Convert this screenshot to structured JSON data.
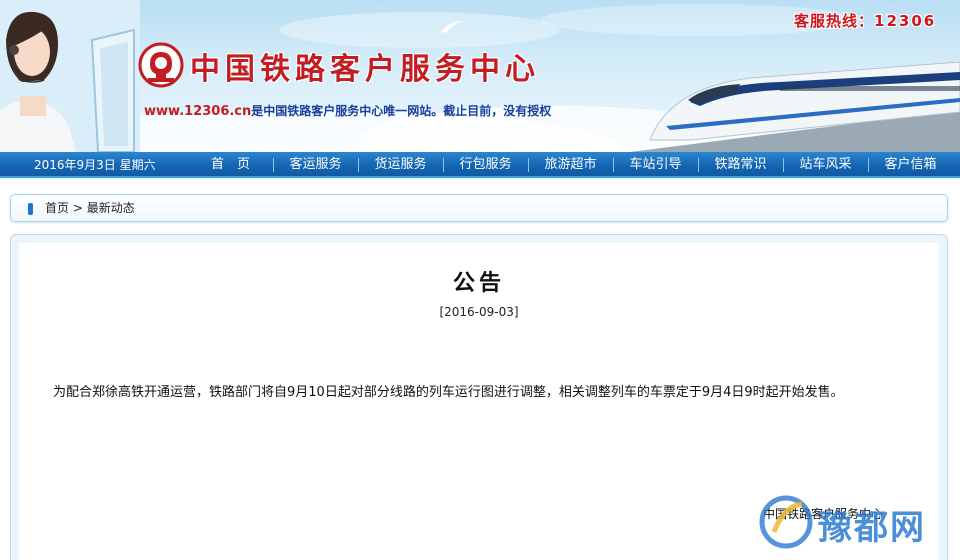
{
  "header": {
    "site_title": "中国铁路客户服务中心",
    "site_url": "www.12306.cn",
    "site_notice": "是中国铁路客户服务中心唯一网站。截止目前，没有授权",
    "hotline_label": "客服热线：",
    "hotline_number": "12306"
  },
  "nav": {
    "date": "2016年9月3日 星期六",
    "items": [
      "首　页",
      "客运服务",
      "货运服务",
      "行包服务",
      "旅游超市",
      "车站引导",
      "铁路常识",
      "站车风采",
      "客户信箱"
    ]
  },
  "breadcrumb": {
    "home": "首页",
    "separator": ">",
    "current": "最新动态"
  },
  "announcement": {
    "title": "公告",
    "date": "[2016-09-03]",
    "body": "为配合郑徐高铁开通运营，铁路部门将自9月10日起对部分线路的列车运行图进行调整，相关调整列车的车票定于9月4日9时起开始发售。",
    "signature": "中国铁路客户服务中心"
  },
  "watermark": {
    "text": "豫都网"
  },
  "colors": {
    "brand_red": "#c21d22",
    "nav_blue": "#1566b3",
    "accent_blue": "#1a78cc"
  }
}
